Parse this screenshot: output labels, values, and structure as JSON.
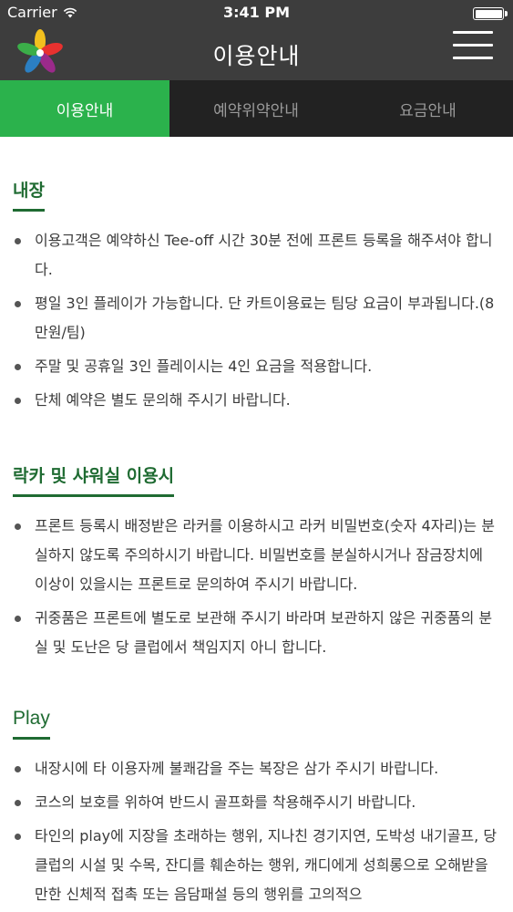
{
  "status_bar": {
    "carrier": "Carrier",
    "time": "3:41 PM"
  },
  "nav": {
    "title": "이용안내",
    "logo_icon": "flower-logo-icon",
    "menu_icon": "hamburger-menu-icon"
  },
  "tabs": [
    {
      "label": "이용안내",
      "active": true
    },
    {
      "label": "예약위약안내",
      "active": false
    },
    {
      "label": "요금안내",
      "active": false
    }
  ],
  "sections": [
    {
      "title": "내장",
      "items": [
        "이용고객은 예약하신 Tee-off 시간 30분 전에 프론트 등록을 해주셔야 합니다.",
        "평일 3인 플레이가 가능합니다. 단 카트이용료는 팀당 요금이 부과됩니다.(8만원/팀)",
        "주말 및 공휴일 3인 플레이시는 4인 요금을 적용합니다.",
        "단체 예약은 별도 문의해 주시기 바랍니다."
      ]
    },
    {
      "title": "락카 및 샤워실 이용시",
      "items": [
        "프론트 등록시 배정받은 라커를 이용하시고 라커 비밀번호(숫자 4자리)는 분실하지 않도록 주의하시기 바랍니다. 비밀번호를 분실하시거나 잠금장치에 이상이 있을시는 프론트로 문의하여 주시기 바랍니다.",
        "귀중품은 프론트에 별도로 보관해 주시기 바라며 보관하지 않은 귀중품의 분실 및 도난은 당 클럽에서 책임지지 아니 합니다."
      ]
    },
    {
      "title": "Play",
      "items": [
        "내장시에 타 이용자께 불쾌감을 주는 복장은 삼가 주시기 바랍니다.",
        "코스의 보호를 위하여 반드시 골프화를 착용해주시기 바랍니다.",
        "타인의 play에 지장을 초래하는 행위, 지나친 경기지연, 도박성 내기골프, 당 클럽의 시설 및 수목, 잔디를 훼손하는 행위, 캐디에게 성희롱으로 오해받을 만한 신체적 접촉 또는 음담패설 등의 행위를 고의적으"
      ]
    }
  ]
}
